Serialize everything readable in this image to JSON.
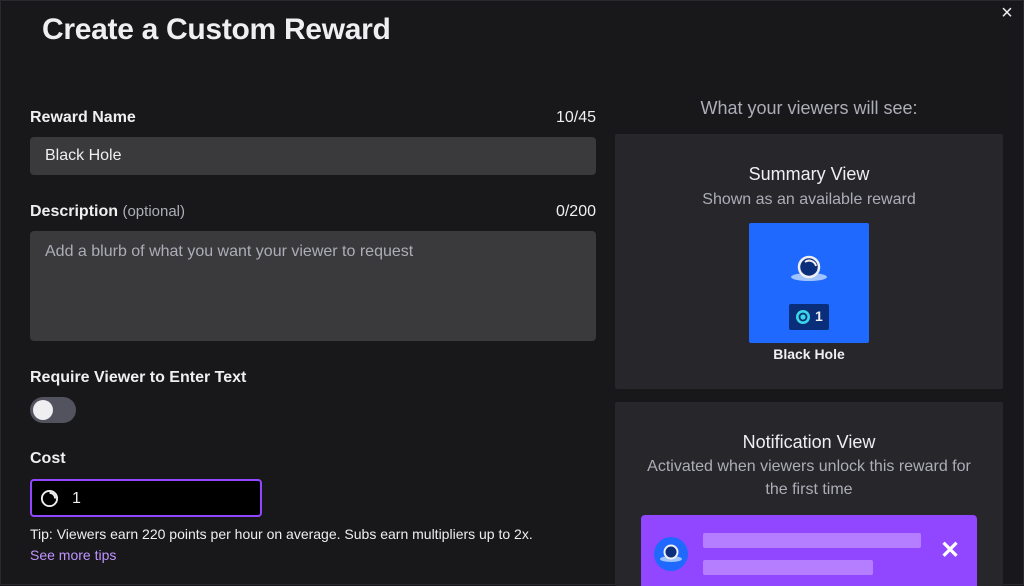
{
  "modal": {
    "title": "Create a Custom Reward",
    "close_label": "×"
  },
  "form": {
    "reward_name": {
      "label": "Reward Name",
      "counter": "10/45",
      "value": "Black Hole"
    },
    "description": {
      "label": "Description",
      "optional": "(optional)",
      "counter": "0/200",
      "placeholder": "Add a blurb of what you want your viewer to request",
      "value": ""
    },
    "require_text": {
      "label": "Require Viewer to Enter Text",
      "enabled": false
    },
    "cost": {
      "label": "Cost",
      "value": "1",
      "icon": "channel-points-icon"
    },
    "tip": "Tip: Viewers earn 220 points per hour on average. Subs earn multipliers up to 2x.",
    "tips_link": "See more tips"
  },
  "preview": {
    "heading": "What your viewers will see:",
    "summary": {
      "title": "Summary View",
      "subtitle": "Shown as an available reward",
      "tile": {
        "name": "Black Hole",
        "cost": "1",
        "color": "#1f69ff",
        "icon": "black-hole-icon"
      }
    },
    "notification": {
      "title": "Notification View",
      "subtitle": "Activated when viewers unlock this reward for the first time",
      "banner_color": "#9147ff",
      "close_label": "✕"
    }
  }
}
